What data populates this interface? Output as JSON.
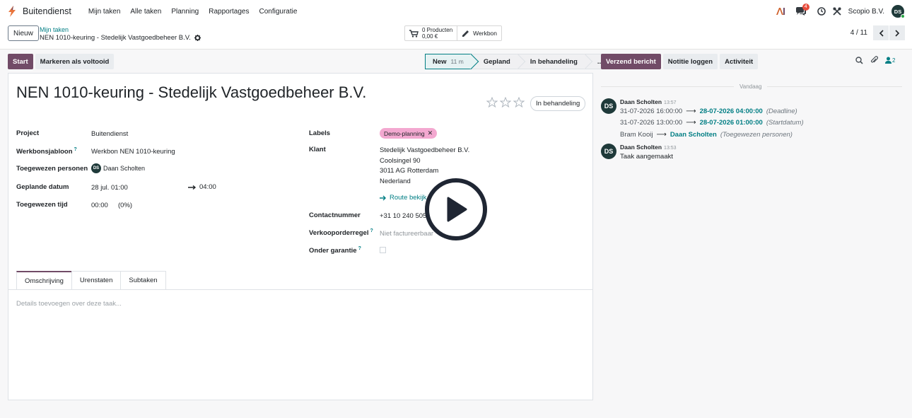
{
  "app": {
    "name": "Buitendienst"
  },
  "menu": [
    "Mijn taken",
    "Alle taken",
    "Planning",
    "Rapportages",
    "Configuratie"
  ],
  "systray": {
    "company": "Scopio B.V.",
    "user_initials": "DS",
    "chat_badge": "4"
  },
  "control": {
    "new_label": "Nieuw",
    "breadcrumb_parent": "Mijn taken",
    "breadcrumb_current": "NEN 1010-keuring - Stedelijk Vastgoedbeheer B.V.",
    "smart_products_line1": "0 Producten",
    "smart_products_line2": "0,00 €",
    "smart_workorder": "Werkbon",
    "pager": "4 / 11"
  },
  "actions": {
    "start": "Start",
    "mark_done": "Markeren als voltooid"
  },
  "statusbar": {
    "stages": [
      {
        "label": "New",
        "duration": "11 m"
      },
      {
        "label": "Gepland"
      },
      {
        "label": "In behandeling"
      },
      {
        "label": "..."
      }
    ]
  },
  "form": {
    "title": "NEN 1010-keuring - Stedelijk Vastgoedbeheer B.V.",
    "state": "In behandeling",
    "stars_total": 3,
    "stars_filled": 0,
    "left": {
      "project_label": "Project",
      "project_value": "Buitendienst",
      "template_label": "Werkbonsjabloon",
      "template_value": "Werkbon NEN 1010-keuring",
      "assignees_label": "Toegewezen personen",
      "assignee_initials": "DS",
      "assignee_name": "Daan Scholten",
      "planned_label": "Geplande datum",
      "planned_start": "28 jul. 01:00",
      "planned_end": "04:00",
      "time_label": "Toegewezen tijd",
      "time_value": "00:00",
      "time_percent": "(0%)"
    },
    "right": {
      "labels_label": "Labels",
      "tag": "Demo-planning",
      "customer_label": "Klant",
      "customer_name": "Stedelijk Vastgoedbeheer B.V.",
      "address_street": "Coolsingel 90",
      "address_city": "3011 AG Rotterdam",
      "address_country": "Nederland",
      "route_link": "Route bekijk",
      "phone_label": "Contactnummer",
      "phone_value": "+31 10 240 5050",
      "sale_line_label": "Verkooporderregel",
      "sale_line_placeholder": "Niet factureerbaar",
      "warranty_label": "Onder garantie"
    },
    "tabs": [
      "Omschrijving",
      "Urenstaten",
      "Subtaken"
    ],
    "description_placeholder": "Details toevoegen over deze taak..."
  },
  "chatter": {
    "send_message": "Verzend bericht",
    "log_note": "Notitie loggen",
    "activity": "Activiteit",
    "followers_count": "2",
    "date_separator": "Vandaag",
    "messages": [
      {
        "initials": "DS",
        "author": "Daan Scholten",
        "time": "13:57",
        "tracking": [
          {
            "old": "31-07-2026 16:00:00",
            "new": "28-07-2026 04:00:00",
            "field": "(Deadline)"
          },
          {
            "old": "31-07-2026 13:00:00",
            "new": "28-07-2026 01:00:00",
            "field": "(Startdatum)"
          },
          {
            "old": "Bram Kooij",
            "new": "Daan Scholten",
            "field": "(Toegewezen personen)"
          }
        ]
      },
      {
        "initials": "DS",
        "author": "Daan Scholten",
        "time": "13:53",
        "body": "Taak aangemaakt"
      }
    ]
  },
  "colors": {
    "primary": "#714b67",
    "link": "#017e84",
    "tag": "#f3a8d0"
  }
}
